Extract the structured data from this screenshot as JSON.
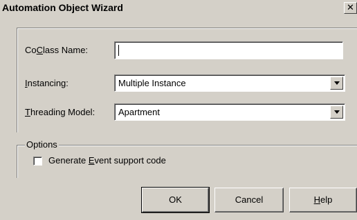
{
  "window": {
    "title": "Automation Object Wizard",
    "close_glyph": "✕"
  },
  "fields": {
    "coclass": {
      "label_pre": "Co",
      "label_key": "C",
      "label_post": "lass Name:",
      "value": ""
    },
    "instancing": {
      "label_pre": "",
      "label_key": "I",
      "label_post": "nstancing:",
      "value": "Multiple Instance"
    },
    "threading": {
      "label_pre": "",
      "label_key": "T",
      "label_post": "hreading Model:",
      "value": "Apartment"
    }
  },
  "options": {
    "title": "Options",
    "event_support": {
      "label_pre": "Generate ",
      "label_key": "E",
      "label_post": "vent support code",
      "checked": false
    }
  },
  "buttons": {
    "ok": "OK",
    "cancel": "Cancel",
    "help_key": "H",
    "help_rest": "elp"
  },
  "icons": {
    "close": "close-icon",
    "dropdown": "chevron-down-icon"
  }
}
